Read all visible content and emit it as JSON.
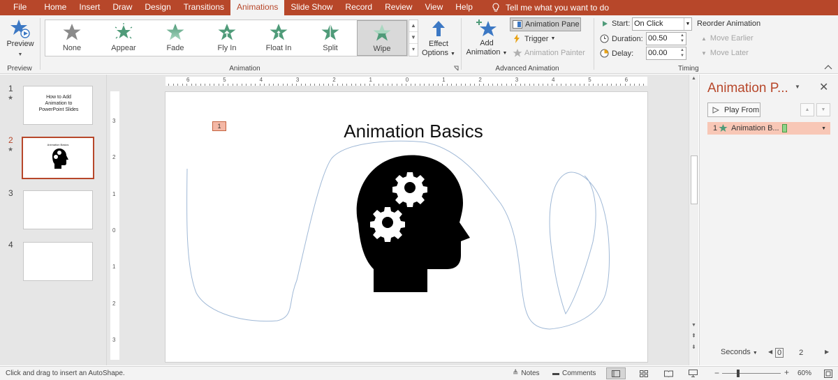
{
  "tabs": [
    "File",
    "Home",
    "Insert",
    "Draw",
    "Design",
    "Transitions",
    "Animations",
    "Slide Show",
    "Record",
    "Review",
    "View",
    "Help"
  ],
  "tell_me": "Tell me what you want to do",
  "ribbon": {
    "preview": {
      "label": "Preview",
      "group": "Preview"
    },
    "animation_gallery": {
      "items": [
        {
          "label": "None",
          "color": "#8a8a8a"
        },
        {
          "label": "Appear",
          "color": "#4f9b79"
        },
        {
          "label": "Fade",
          "color": "#4f9b79"
        },
        {
          "label": "Fly In",
          "color": "#4f9b79"
        },
        {
          "label": "Float In",
          "color": "#4f9b79"
        },
        {
          "label": "Split",
          "color": "#4f9b79"
        },
        {
          "label": "Wipe",
          "color": "#4f9b79"
        }
      ],
      "selected": "Wipe",
      "group": "Animation"
    },
    "effect_options": [
      "Effect",
      "Options"
    ],
    "advanced": {
      "add_animation": [
        "Add",
        "Animation"
      ],
      "animation_pane": "Animation Pane",
      "trigger": "Trigger",
      "animation_painter": "Animation Painter",
      "group": "Advanced Animation"
    },
    "timing": {
      "start_label": "Start:",
      "start_value": "On Click",
      "duration_label": "Duration:",
      "duration_value": "00.50",
      "delay_label": "Delay:",
      "delay_value": "00.00",
      "reorder": "Reorder Animation",
      "move_earlier": "Move Earlier",
      "move_later": "Move Later",
      "group": "Timing"
    }
  },
  "thumbnails": [
    {
      "num": "1",
      "star": "★",
      "text": "How to Add Animation to PowerPoint Slides"
    },
    {
      "num": "2",
      "star": "★",
      "text": "Animation Basics"
    },
    {
      "num": "3",
      "star": "",
      "text": ""
    },
    {
      "num": "4",
      "star": "",
      "text": ""
    }
  ],
  "slide": {
    "title": "Animation Basics",
    "anim_tag": "1"
  },
  "ruler": {
    "h_ticks": [
      "6",
      "5",
      "4",
      "3",
      "2",
      "1",
      "0",
      "1",
      "2",
      "3",
      "4",
      "5",
      "6"
    ],
    "v_ticks": [
      "3",
      "2",
      "1",
      "0",
      "1",
      "2",
      "3"
    ]
  },
  "anim_pane": {
    "title": "Animation P...",
    "play_from": "Play From",
    "entries": [
      {
        "num": "1",
        "label": "Animation B..."
      }
    ],
    "seconds": "Seconds",
    "timeline": [
      "0",
      "2"
    ]
  },
  "status": {
    "hint": "Click and drag to insert an AutoShape.",
    "notes": "Notes",
    "comments": "Comments",
    "zoom": "60%"
  },
  "colors": {
    "accent": "#b7472a",
    "star_green": "#4f9b79",
    "blue": "#3c78c4"
  }
}
